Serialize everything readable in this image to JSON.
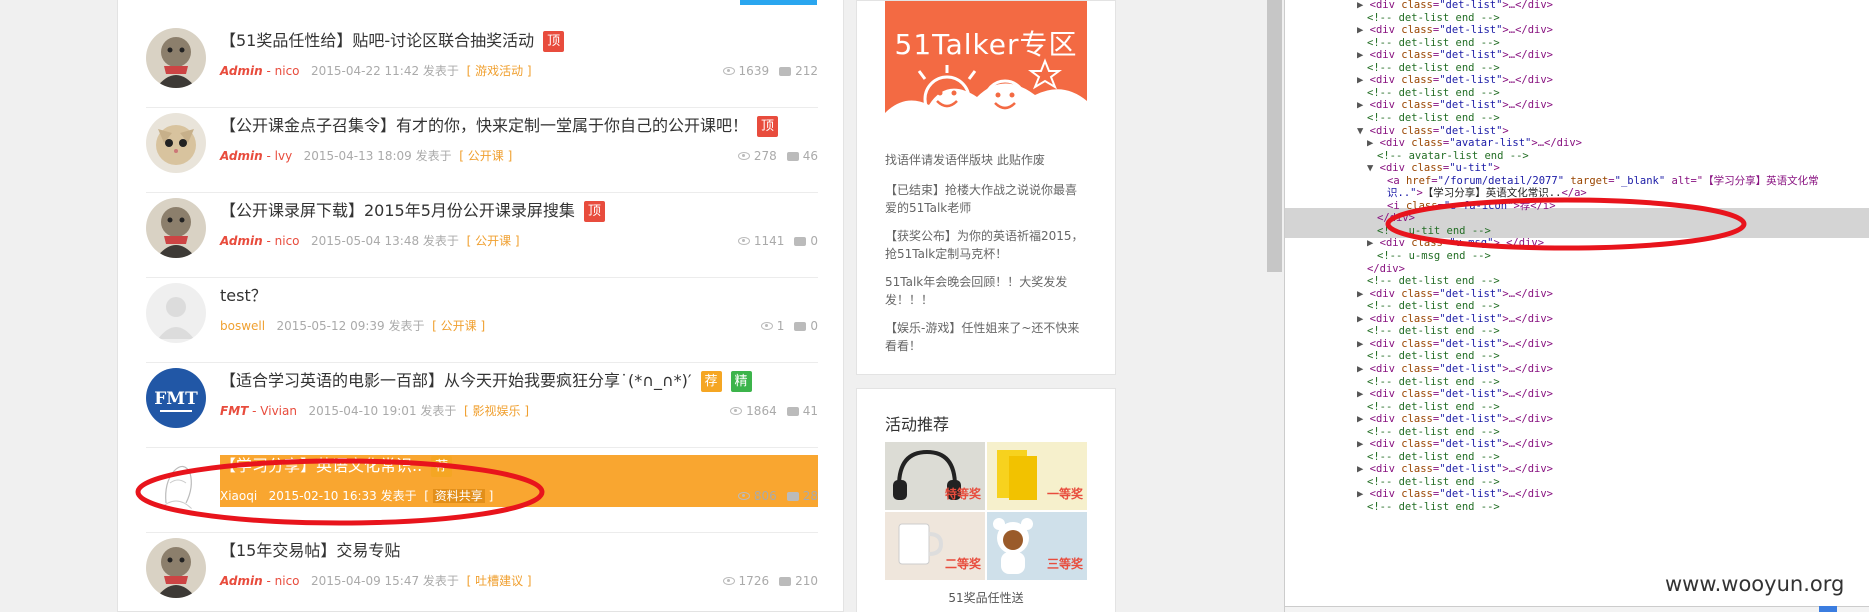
{
  "topics": [
    {
      "title": "【51奖品任性给】贴吧-讨论区联合抽奖活动",
      "badges": [
        "顶"
      ],
      "author_role": "Admin",
      "author_name": "nico",
      "date": "2015-04-22 11:42 发表于",
      "category": "游戏活动",
      "views": "1639",
      "comments": "212",
      "avatar": "cat-scarf"
    },
    {
      "title": "【公开课金点子召集令】有才的你，快来定制一堂属于你自己的公开课吧！",
      "badges": [
        "顶"
      ],
      "author_role": "Admin",
      "author_name": "lvy",
      "date": "2015-04-13 18:09 发表于",
      "category": "公开课",
      "views": "278",
      "comments": "46",
      "avatar": "cat-face"
    },
    {
      "title": "【公开课录屏下载】2015年5月份公开课录屏搜集",
      "badges": [
        "顶"
      ],
      "author_role": "Admin",
      "author_name": "nico",
      "date": "2015-05-04 13:48 发表于",
      "category": "公开课",
      "views": "1141",
      "comments": "0",
      "avatar": "cat-scarf"
    },
    {
      "title": "test？",
      "badges": [],
      "author_role": "",
      "author_name": "boswell",
      "date": "2015-05-12 09:39 发表于",
      "category": "公开课",
      "views": "1",
      "comments": "0",
      "avatar": "default"
    },
    {
      "title": "【适合学习英语的电影一百部】从今天开始我要疯狂分享˙(*∩_∩*)′",
      "badges": [
        "荐",
        "精"
      ],
      "author_role": "FMT",
      "author_name": "Vivian",
      "date": "2015-04-10 19:01 发表于",
      "category": "影视娱乐",
      "views": "1864",
      "comments": "41",
      "avatar": "fmt"
    },
    {
      "title": "【学习分享】英语文化常识..",
      "badges": [
        "荐"
      ],
      "author_role": "",
      "author_name": "Xiaoqi",
      "date": "2015-02-10 16:33 发表于",
      "category": "资料共享",
      "views": "806",
      "comments": "28",
      "avatar": "sketch",
      "highlight": true
    },
    {
      "title": "【15年交易帖】交易专贴",
      "badges": [],
      "author_role": "Admin",
      "author_name": "nico",
      "date": "2015-04-09 15:47 发表于",
      "category": "吐槽建议",
      "views": "1726",
      "comments": "210",
      "avatar": "cat-scarf"
    }
  ],
  "promo": {
    "title": "51Talker专区"
  },
  "side_links": [
    "找语伴请发语伴版块 此贴作废",
    "【已结束】抢楼大作战之说说你最喜爱的51Talk老师",
    "【获奖公布】为你的英语祈福2015，抢51Talk定制马克杯！",
    "51Talk年会晚会回顾！！大奖发发发！！！",
    "【娱乐-游戏】任性姐来了~还不快来看看！"
  ],
  "activity": {
    "title": "活动推荐",
    "prizes": [
      "特等奖",
      "一等奖",
      "二等奖",
      "三等奖"
    ],
    "caption": "51奖品任性送"
  },
  "devtools": {
    "lines": [
      {
        "indent": 0,
        "tri": "▶",
        "kind": "div",
        "text": "<div class=\"det-list\">…</div>"
      },
      {
        "indent": 0,
        "kind": "comment",
        "text": "<!-- det-list end -->"
      },
      {
        "indent": 0,
        "tri": "▶",
        "kind": "div",
        "text": "<div class=\"det-list\">…</div>"
      },
      {
        "indent": 0,
        "kind": "comment",
        "text": "<!-- det-list end -->"
      },
      {
        "indent": 0,
        "tri": "▶",
        "kind": "div",
        "text": "<div class=\"det-list\">…</div>"
      },
      {
        "indent": 0,
        "kind": "comment",
        "text": "<!-- det-list end -->"
      },
      {
        "indent": 0,
        "tri": "▶",
        "kind": "div",
        "text": "<div class=\"det-list\">…</div>"
      },
      {
        "indent": 0,
        "kind": "comment",
        "text": "<!-- det-list end -->"
      },
      {
        "indent": 0,
        "tri": "▶",
        "kind": "div",
        "text": "<div class=\"det-list\">…</div>"
      },
      {
        "indent": 0,
        "kind": "comment",
        "text": "<!-- det-list end -->"
      },
      {
        "indent": 0,
        "tri": "▼",
        "kind": "div",
        "text": "<div class=\"det-list\">"
      },
      {
        "indent": 1,
        "tri": "▶",
        "kind": "div",
        "text": "<div class=\"avatar-list\">…</div>"
      },
      {
        "indent": 1,
        "kind": "comment",
        "text": "<!-- avatar-list end -->"
      },
      {
        "indent": 1,
        "tri": "▼",
        "kind": "div",
        "text": "<div class=\"u-tit\">"
      },
      {
        "indent": 2,
        "kind": "anchor",
        "text": "<a href=\"/forum/detail/2077\" target=\"_blank\" alt=\"【学习分享】英语文化常"
      },
      {
        "indent": 2,
        "kind": "anchor2",
        "text": "识..\">【学习分享】英语文化常识..</a>"
      },
      {
        "indent": 2,
        "kind": "div",
        "text": "<i class=\"s-fa-icon\">荐</i>"
      },
      {
        "indent": 1,
        "kind": "div",
        "text": "</div>"
      },
      {
        "indent": 1,
        "kind": "comment",
        "text": "<!-- u-tit end -->"
      },
      {
        "indent": 1,
        "tri": "▶",
        "kind": "div",
        "text": "<div class=\"u-msg\">…</div>"
      },
      {
        "indent": 1,
        "kind": "comment",
        "text": "<!-- u-msg end -->"
      },
      {
        "indent": 0,
        "kind": "div",
        "text": "</div>"
      },
      {
        "indent": 0,
        "kind": "comment",
        "text": "<!-- det-list end -->"
      },
      {
        "indent": 0,
        "tri": "▶",
        "kind": "div",
        "text": "<div class=\"det-list\">…</div>"
      },
      {
        "indent": 0,
        "kind": "comment",
        "text": "<!-- det-list end -->"
      },
      {
        "indent": 0,
        "tri": "▶",
        "kind": "div",
        "text": "<div class=\"det-list\">…</div>"
      },
      {
        "indent": 0,
        "kind": "comment",
        "text": "<!-- det-list end -->"
      },
      {
        "indent": 0,
        "tri": "▶",
        "kind": "div",
        "text": "<div class=\"det-list\">…</div>"
      },
      {
        "indent": 0,
        "kind": "comment",
        "text": "<!-- det-list end -->"
      },
      {
        "indent": 0,
        "tri": "▶",
        "kind": "div",
        "text": "<div class=\"det-list\">…</div>"
      },
      {
        "indent": 0,
        "kind": "comment",
        "text": "<!-- det-list end -->"
      },
      {
        "indent": 0,
        "tri": "▶",
        "kind": "div",
        "text": "<div class=\"det-list\">…</div>"
      },
      {
        "indent": 0,
        "kind": "comment",
        "text": "<!-- det-list end -->"
      },
      {
        "indent": 0,
        "tri": "▶",
        "kind": "div",
        "text": "<div class=\"det-list\">…</div>"
      },
      {
        "indent": 0,
        "kind": "comment",
        "text": "<!-- det-list end -->"
      },
      {
        "indent": 0,
        "tri": "▶",
        "kind": "div",
        "text": "<div class=\"det-list\">…</div>"
      },
      {
        "indent": 0,
        "kind": "comment",
        "text": "<!-- det-list end -->"
      },
      {
        "indent": 0,
        "tri": "▶",
        "kind": "div",
        "text": "<div class=\"det-list\">…</div>"
      },
      {
        "indent": 0,
        "kind": "comment",
        "text": "<!-- det-list end -->"
      },
      {
        "indent": 0,
        "tri": "▶",
        "kind": "div",
        "text": "<div class=\"det-list\">…</div>"
      },
      {
        "indent": 0,
        "kind": "comment",
        "text": "<!-- det-list end -->"
      }
    ]
  },
  "watermark": "www.wooyun.org",
  "colors": {
    "accent": "#f9a630",
    "badge_top": "#e84c3d",
    "badge_rec": "#f5a623",
    "badge_elite": "#3cb44b",
    "promo": "#f36a43",
    "annotation": "#e8141c"
  }
}
